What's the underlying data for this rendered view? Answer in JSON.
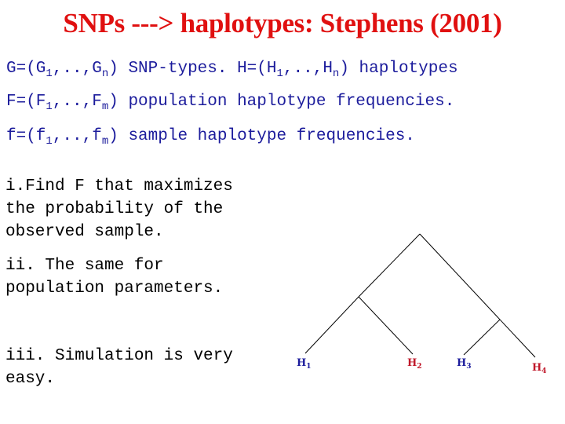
{
  "title": "SNPs ---> haplotypes: Stephens (2001)",
  "definitions": [
    {
      "pre": "G=(G",
      "s1": "1",
      "mid": ",..,G",
      "s2": "n",
      "post": ") SNP-types. H=(H",
      "s3": "1",
      "mid2": ",..,H",
      "s4": "n",
      "post2": ") haplotypes"
    },
    {
      "pre": "F=(F",
      "s1": "1",
      "mid": ",..,F",
      "s2": "m",
      "post": ") population haplotype frequencies."
    },
    {
      "pre": "f=(f",
      "s1": "1",
      "mid": ",..,f",
      "s2": "m",
      "post": ") sample haplotype frequencies."
    }
  ],
  "points": [
    "i.Find F that maximizes\nthe probability of the\nobserved sample.",
    "ii. The same for\npopulation parameters.",
    "iii. Simulation is very\neasy."
  ],
  "tree": {
    "leaves": [
      {
        "label": "H",
        "sub": "1",
        "color": "#1c1c9c"
      },
      {
        "label": "H",
        "sub": "2",
        "color": "#c0182a"
      },
      {
        "label": "H",
        "sub": "3",
        "color": "#1c1c9c"
      },
      {
        "label": "H",
        "sub": "4",
        "color": "#c0182a"
      }
    ]
  }
}
